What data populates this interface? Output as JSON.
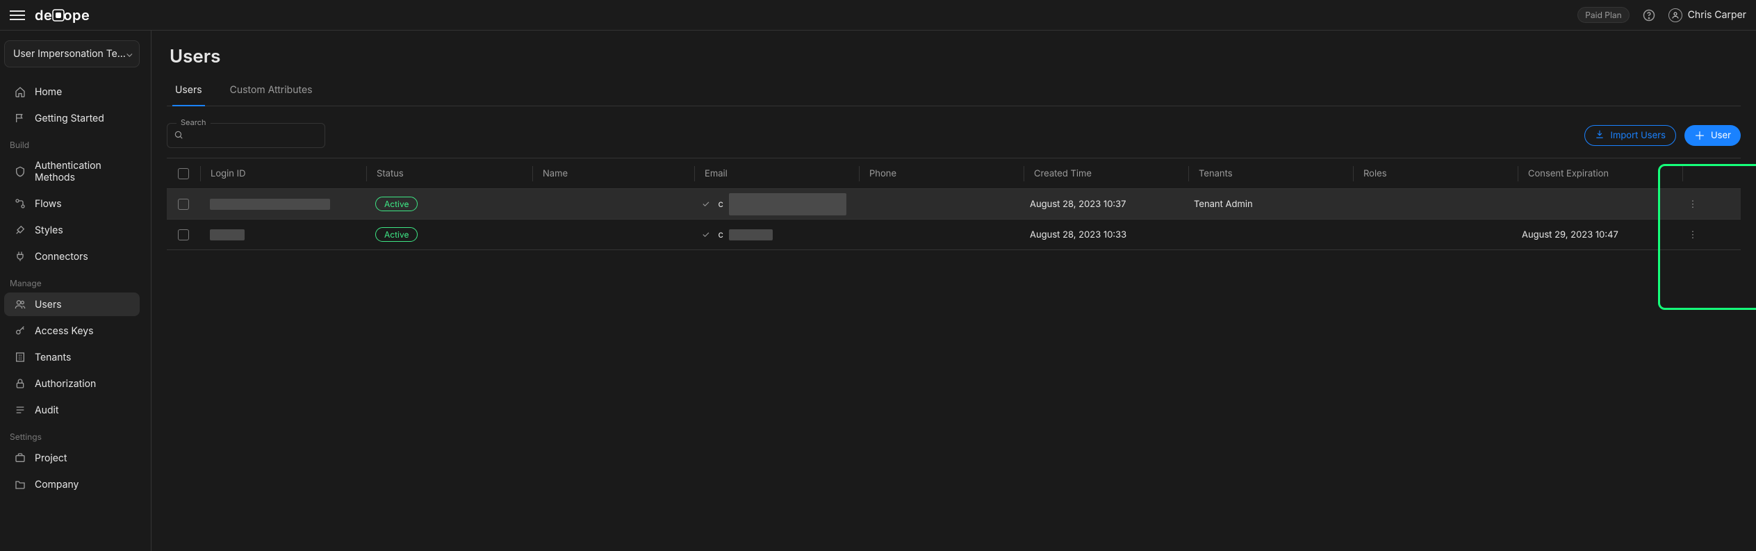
{
  "topbar": {
    "logo_text": "descope",
    "plan_badge": "Paid Plan",
    "user_name": "Chris Carper"
  },
  "sidebar": {
    "project_name": "User Impersonation Te…",
    "sections": {
      "home": "Home",
      "getting_started": "Getting Started",
      "build_label": "Build",
      "auth_methods": "Authentication Methods",
      "flows": "Flows",
      "styles": "Styles",
      "connectors": "Connectors",
      "manage_label": "Manage",
      "users": "Users",
      "access_keys": "Access Keys",
      "tenants": "Tenants",
      "authorization": "Authorization",
      "audit": "Audit",
      "settings_label": "Settings",
      "project": "Project",
      "company": "Company"
    }
  },
  "page": {
    "title": "Users",
    "tabs": {
      "users": "Users",
      "custom_attributes": "Custom Attributes"
    },
    "search_label": "Search",
    "buttons": {
      "import": "Import Users",
      "add": "User"
    },
    "columns": {
      "login_id": "Login ID",
      "status": "Status",
      "name": "Name",
      "email": "Email",
      "phone": "Phone",
      "created": "Created Time",
      "tenants": "Tenants",
      "roles": "Roles",
      "consent": "Consent Expiration"
    },
    "rows": [
      {
        "login_id": "████ ██████ ████████",
        "status": "Active",
        "email_prefix": "c",
        "email_rest": "████   ███ █████ ████████",
        "created": "August 28, 2023 10:37",
        "tenants": "Tenant Admin",
        "consent": ""
      },
      {
        "login_id": "███   ██",
        "status": "Active",
        "email_prefix": "c",
        "email_rest": "██ ██   ██",
        "created": "August 28, 2023 10:33",
        "tenants": "",
        "consent": "August 29, 2023 10:47"
      }
    ]
  }
}
